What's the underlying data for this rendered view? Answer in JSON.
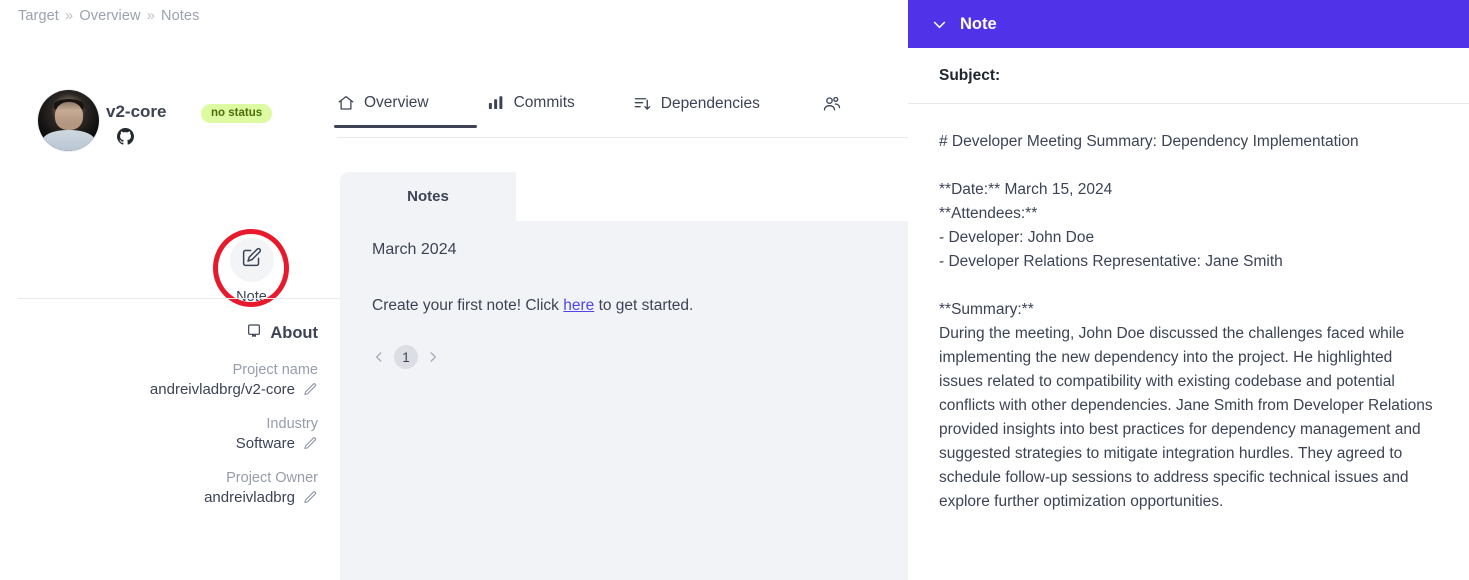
{
  "breadcrumb": {
    "items": [
      "Target",
      "Overview",
      "Notes"
    ],
    "separator": "»"
  },
  "profile": {
    "name": "v2-core",
    "status_badge": "no status",
    "source_icon": "github-icon",
    "avatar_alt": "user-avatar"
  },
  "actions": {
    "note_label": "Note",
    "note_icon": "edit-square-icon",
    "highlight_color": "#e8192c"
  },
  "about": {
    "title": "About",
    "title_icon": "book-icon",
    "rows": [
      {
        "key": "Project name",
        "value": "andreivladbrg/v2-core",
        "edit_icon": "pencil-icon"
      },
      {
        "key": "Industry",
        "value": "Software",
        "edit_icon": "pencil-icon"
      },
      {
        "key": "Project Owner",
        "value": "andreivladbrg",
        "edit_icon": "pencil-icon"
      }
    ]
  },
  "tabs": [
    {
      "label": "Overview",
      "icon": "home-icon",
      "active": true
    },
    {
      "label": "Commits",
      "icon": "bar-chart-icon",
      "active": false
    },
    {
      "label": "Dependencies",
      "icon": "sort-arrow-icon",
      "active": false
    },
    {
      "label": "",
      "icon": "people-icon",
      "active": false
    }
  ],
  "notes_panel": {
    "tab_label": "Notes",
    "month": "March 2024",
    "empty_prefix": "Create your first note! Click ",
    "empty_link": "here",
    "empty_suffix": " to get started.",
    "pagination": {
      "prev_icon": "chevron-left-icon",
      "page": "1",
      "next_icon": "chevron-right-icon"
    }
  },
  "note_panel": {
    "header_title": "Note",
    "header_icon": "chevron-down-icon",
    "header_color": "#5033e8",
    "subject_label": "Subject:",
    "body": "# Developer Meeting Summary: Dependency Implementation\n\n**Date:** March 15, 2024\n**Attendees:**\n- Developer: John Doe\n- Developer Relations Representative: Jane Smith\n\n**Summary:**\nDuring the meeting, John Doe discussed the challenges faced while implementing the new dependency into the project. He highlighted issues related to compatibility with existing codebase and potential conflicts with other dependencies. Jane Smith from Developer Relations provided insights into best practices for dependency management and suggested strategies to mitigate integration hurdles. They agreed to schedule follow-up sessions to address specific technical issues and explore further optimization opportunities."
  }
}
